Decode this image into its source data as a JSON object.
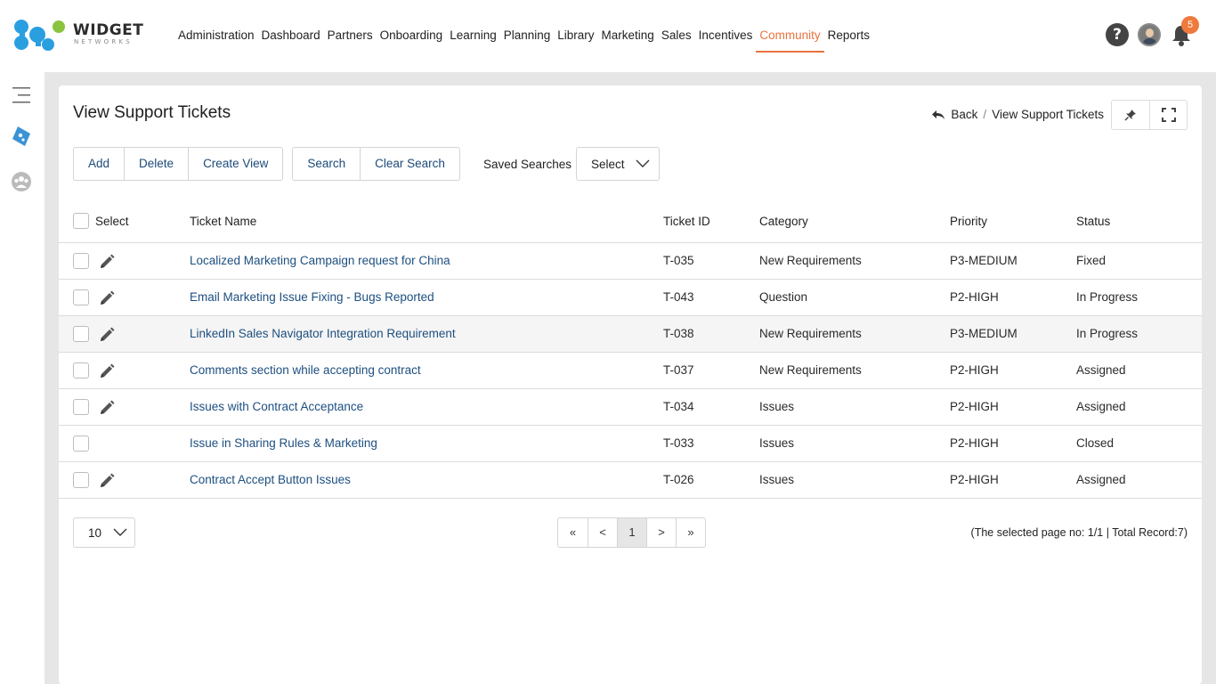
{
  "logo": {
    "text": "WIDGET",
    "subtext": "NETWORKS"
  },
  "nav": [
    {
      "label": "Administration",
      "active": false
    },
    {
      "label": "Dashboard",
      "active": false
    },
    {
      "label": "Partners",
      "active": false
    },
    {
      "label": "Onboarding",
      "active": false
    },
    {
      "label": "Learning",
      "active": false
    },
    {
      "label": "Planning",
      "active": false
    },
    {
      "label": "Library",
      "active": false
    },
    {
      "label": "Marketing",
      "active": false
    },
    {
      "label": "Sales",
      "active": false
    },
    {
      "label": "Incentives",
      "active": false
    },
    {
      "label": "Community",
      "active": true
    },
    {
      "label": "Reports",
      "active": false
    }
  ],
  "header_icons": {
    "help": "?",
    "notifications_count": "5"
  },
  "sidebar_icons": [
    "menu-icon",
    "ticket-icon",
    "community-icon"
  ],
  "page": {
    "title": "View Support Tickets",
    "breadcrumb_back": "Back",
    "breadcrumb_sep": "/",
    "breadcrumb_current": "View Support Tickets"
  },
  "toolbar": {
    "add": "Add",
    "delete": "Delete",
    "create_view": "Create View",
    "search": "Search",
    "clear_search": "Clear Search",
    "saved_searches_label": "Saved Searches",
    "saved_searches_value": "Select"
  },
  "table": {
    "headers": {
      "select": "Select",
      "name": "Ticket Name",
      "id": "Ticket ID",
      "category": "Category",
      "priority": "Priority",
      "status": "Status"
    },
    "rows": [
      {
        "name": "Localized Marketing Campaign request for China",
        "id": "T-035",
        "category": "New Requirements",
        "priority": "P3-MEDIUM",
        "status": "Fixed",
        "editable": true
      },
      {
        "name": "Email Marketing Issue Fixing - Bugs Reported",
        "id": "T-043",
        "category": "Question",
        "priority": "P2-HIGH",
        "status": "In Progress",
        "editable": true
      },
      {
        "name": "LinkedIn Sales Navigator Integration Requirement",
        "id": "T-038",
        "category": "New Requirements",
        "priority": "P3-MEDIUM",
        "status": "In Progress",
        "editable": true
      },
      {
        "name": "Comments section while accepting contract",
        "id": "T-037",
        "category": "New Requirements",
        "priority": "P2-HIGH",
        "status": "Assigned",
        "editable": true
      },
      {
        "name": "Issues with Contract Acceptance",
        "id": "T-034",
        "category": "Issues",
        "priority": "P2-HIGH",
        "status": "Assigned",
        "editable": true
      },
      {
        "name": "Issue in Sharing Rules & Marketing",
        "id": "T-033",
        "category": "Issues",
        "priority": "P2-HIGH",
        "status": "Closed",
        "editable": false
      },
      {
        "name": "Contract Accept Button Issues",
        "id": "T-026",
        "category": "Issues",
        "priority": "P2-HIGH",
        "status": "Assigned",
        "editable": true
      }
    ]
  },
  "pagination": {
    "per_page": "10",
    "first": "«",
    "prev": "<",
    "current": "1",
    "next": ">",
    "last": "»",
    "info": "(The selected page no: 1/1 | Total Record:7)"
  },
  "colors": {
    "accent": "#e8733e",
    "link": "#1d4f80",
    "brand_blue": "#2a9fe0",
    "brand_green": "#8ac43f"
  }
}
